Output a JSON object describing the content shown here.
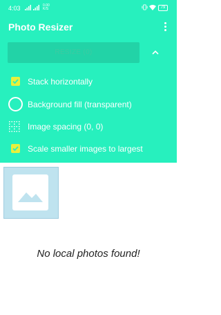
{
  "status_bar": {
    "time": "4:03",
    "network_speed_top": "0.00",
    "network_speed_bottom": "K/S",
    "battery": "79"
  },
  "app_bar": {
    "title": "Photo Resizer",
    "menu_icon": "more-vert-icon"
  },
  "toolbar": {
    "resize_label": "RESIZE (0)",
    "collapse_icon": "chevron-up-icon"
  },
  "options": [
    {
      "label": "Stack horizontally",
      "icon": "checkbox-checked-icon",
      "checked": true
    },
    {
      "label": "Background fill (transparent)",
      "icon": "circle-icon"
    },
    {
      "label": "Image spacing (0, 0)",
      "icon": "dotted-grid-icon"
    },
    {
      "label": "Scale smaller images to largest",
      "icon": "checkbox-checked-icon",
      "checked": true
    }
  ],
  "content": {
    "placeholder_icon": "image-placeholder-icon",
    "empty_message": "No local photos found!"
  },
  "colors": {
    "accent": "#27f0be",
    "checkbox": "#e8f03c",
    "thumbnail_bg": "#bfe3ef"
  }
}
